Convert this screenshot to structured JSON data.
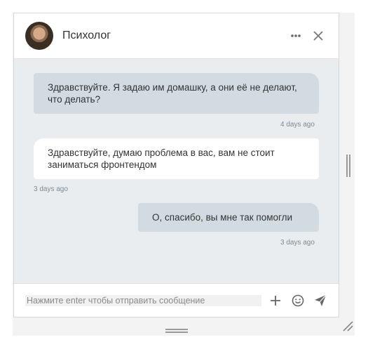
{
  "header": {
    "title": "Психолог",
    "avatar_icon": "user-avatar",
    "more_icon": "ellipsis-icon",
    "close_icon": "close-icon"
  },
  "messages": [
    {
      "direction": "outgoing",
      "text": "Здравствуйте. Я задаю им домашку, а они её не делают, что делать?",
      "time": "4 days ago"
    },
    {
      "direction": "incoming",
      "text": "Здравствуйте, думаю проблема в вас, вам не стоит заниматься фронтендом",
      "time": "3 days ago"
    },
    {
      "direction": "outgoing",
      "text": "О, спасибо, вы мне так помогли",
      "time": "3 days ago"
    }
  ],
  "composer": {
    "placeholder": "Нажмите enter чтобы отправить сообщение",
    "value": "",
    "icons": [
      "plus-icon",
      "emoji-icon",
      "send-icon"
    ]
  },
  "colors": {
    "outgoing_bubble": "#d2dbe1",
    "incoming_bubble": "#ffffff",
    "thread_background": "#e9edf0"
  }
}
